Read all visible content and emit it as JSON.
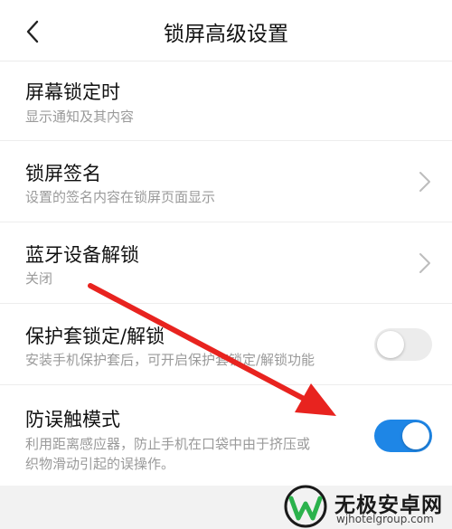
{
  "header": {
    "title": "锁屏高级设置",
    "back_icon": "chevron-left-icon"
  },
  "settings": [
    {
      "title": "屏幕锁定时",
      "subtitle": "显示通知及其内容"
    },
    {
      "title": "锁屏签名",
      "subtitle": "设置的签名内容在锁屏页面显示",
      "control": "chevron"
    },
    {
      "title": "蓝牙设备解锁",
      "subtitle": "关闭",
      "control": "chevron"
    },
    {
      "title": "保护套锁定/解锁",
      "subtitle": "安装手机保护套后，可开启保护套锁定/解锁功能",
      "control": "switch",
      "enabled": false
    },
    {
      "title": "防误触模式",
      "subtitle_line1": "利用距离感应器，防止手机在口袋中由于挤压或",
      "subtitle_line2": "织物滑动引起的误操作。",
      "control": "switch",
      "enabled": true
    }
  ],
  "colors": {
    "accent": "#1e86e6",
    "arrow": "#e8231f",
    "switch_off": "#ececec"
  },
  "watermark": {
    "name": "无极安卓网",
    "url": "wjhotelgroup.com"
  }
}
